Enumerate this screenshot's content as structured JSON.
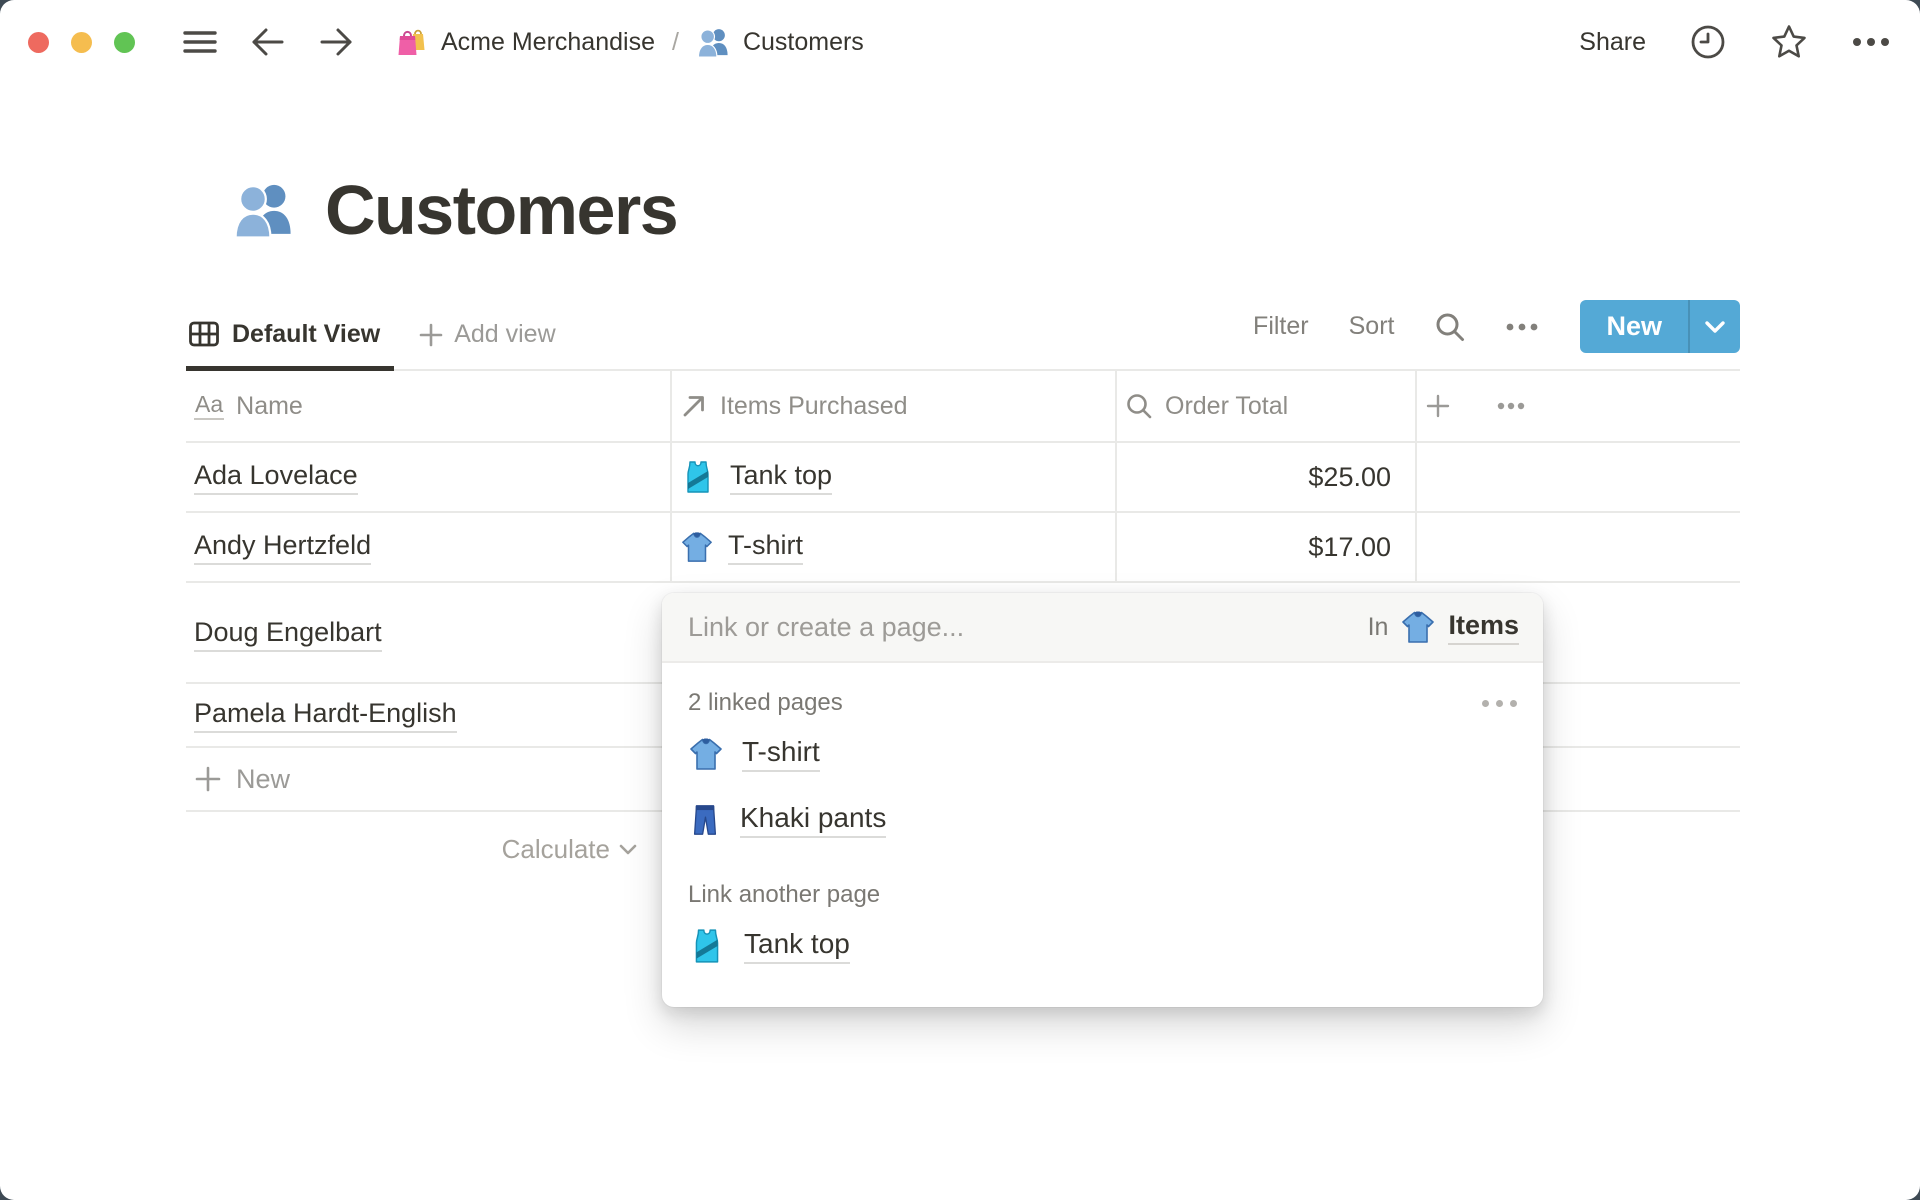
{
  "topbar": {
    "breadcrumb": {
      "workspace": "Acme Merchandise",
      "separator": "/",
      "page": "Customers"
    },
    "share_label": "Share"
  },
  "page": {
    "title": "Customers",
    "icon": "people-icon"
  },
  "view_bar": {
    "active_view": "Default View",
    "add_view_label": "Add view",
    "filter_label": "Filter",
    "sort_label": "Sort",
    "new_button_label": "New"
  },
  "table": {
    "columns": [
      {
        "label": "Name",
        "type_icon": "text-property-icon"
      },
      {
        "label": "Items Purchased",
        "type_icon": "relation-property-icon"
      },
      {
        "label": "Order Total",
        "type_icon": "rollup-property-icon"
      }
    ],
    "rows": [
      {
        "name": "Ada Lovelace",
        "item": "Tank top",
        "item_icon": "tank-top-icon",
        "total": "$25.00"
      },
      {
        "name": "Andy Hertzfeld",
        "item": "T-shirt",
        "item_icon": "t-shirt-icon",
        "total": "$17.00"
      },
      {
        "name": "Doug Engelbart",
        "item": "",
        "item_icon": "",
        "total": ""
      },
      {
        "name": "Pamela Hardt-English",
        "item": "",
        "item_icon": "",
        "total": ""
      }
    ],
    "new_row_label": "New",
    "calculate_label": "Calculate"
  },
  "popup": {
    "placeholder": "Link or create a page...",
    "in_label": "In",
    "in_target": "Items",
    "in_target_icon": "t-shirt-icon",
    "linked_section_label": "2 linked pages",
    "linked_pages": [
      {
        "label": "T-shirt",
        "icon": "t-shirt-icon"
      },
      {
        "label": "Khaki pants",
        "icon": "jeans-icon"
      }
    ],
    "link_another_label": "Link another page",
    "suggestions": [
      {
        "label": "Tank top",
        "icon": "tank-top-icon"
      }
    ]
  },
  "colors": {
    "accent_blue": "#54a9d6",
    "text_dark": "#37352f",
    "text_gray": "#9b9a97",
    "grid_border": "#e9e9e7",
    "window_surround": "#3e4a54",
    "traffic_red": "#ee6a5f",
    "traffic_yellow": "#f5bd4f",
    "traffic_green": "#61c454"
  }
}
